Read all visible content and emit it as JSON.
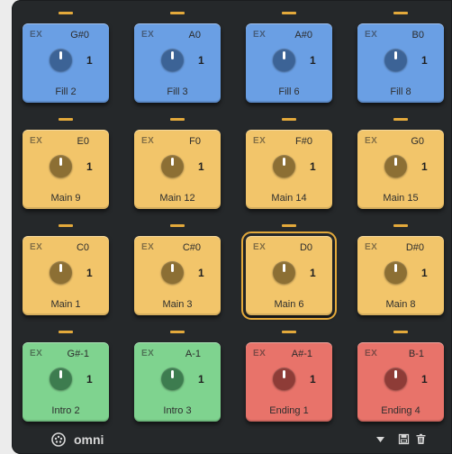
{
  "pads": [
    {
      "ex": "EX",
      "note": "G#0",
      "value": "1",
      "name": "Fill 2",
      "color": "blue"
    },
    {
      "ex": "EX",
      "note": "A0",
      "value": "1",
      "name": "Fill 3",
      "color": "blue"
    },
    {
      "ex": "EX",
      "note": "A#0",
      "value": "1",
      "name": "Fill 6",
      "color": "blue"
    },
    {
      "ex": "EX",
      "note": "B0",
      "value": "1",
      "name": "Fill 8",
      "color": "blue"
    },
    {
      "ex": "EX",
      "note": "E0",
      "value": "1",
      "name": "Main 9",
      "color": "yellow"
    },
    {
      "ex": "EX",
      "note": "F0",
      "value": "1",
      "name": "Main 12",
      "color": "yellow"
    },
    {
      "ex": "EX",
      "note": "F#0",
      "value": "1",
      "name": "Main 14",
      "color": "yellow"
    },
    {
      "ex": "EX",
      "note": "G0",
      "value": "1",
      "name": "Main 15",
      "color": "yellow"
    },
    {
      "ex": "EX",
      "note": "C0",
      "value": "1",
      "name": "Main 1",
      "color": "yellow"
    },
    {
      "ex": "EX",
      "note": "C#0",
      "value": "1",
      "name": "Main 3",
      "color": "yellow"
    },
    {
      "ex": "EX",
      "note": "D0",
      "value": "1",
      "name": "Main 6",
      "color": "yellow",
      "selected": true
    },
    {
      "ex": "EX",
      "note": "D#0",
      "value": "1",
      "name": "Main 8",
      "color": "yellow"
    },
    {
      "ex": "EX",
      "note": "G#-1",
      "value": "1",
      "name": "Intro 2",
      "color": "green"
    },
    {
      "ex": "EX",
      "note": "A-1",
      "value": "1",
      "name": "Intro 3",
      "color": "green"
    },
    {
      "ex": "EX",
      "note": "A#-1",
      "value": "1",
      "name": "Ending 1",
      "color": "red"
    },
    {
      "ex": "EX",
      "note": "B-1",
      "value": "1",
      "name": "Ending 4",
      "color": "red"
    }
  ],
  "colors": {
    "blue": "#6a9fe4",
    "yellow": "#f2c56a",
    "green": "#7fd38f",
    "red": "#e8736a",
    "indicator": "#e3a93b",
    "panel": "#25282a"
  },
  "footer": {
    "mode_label": "omni",
    "mode_icon": "midi-port-icon",
    "dropdown_icon": "caret-down-icon",
    "save_icon": "save-icon",
    "delete_icon": "trash-icon"
  }
}
